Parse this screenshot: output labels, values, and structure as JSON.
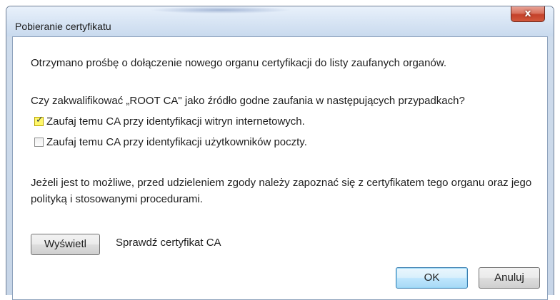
{
  "window": {
    "title": "Pobieranie certyfikatu",
    "close_label": "x"
  },
  "dialog": {
    "message": "Otrzymano prośbę o dołączenie nowego organu certyfikacji do listy zaufanych organów.",
    "question": "Czy zakwalifikować „ROOT CA\" jako źródło godne zaufania w następujących przypadkach?",
    "options": [
      {
        "label": "Zaufaj temu CA przy identyfikacji witryn internetowych.",
        "checked": true
      },
      {
        "label": "Zaufaj temu CA przy identyfikacji użytkowników poczty.",
        "checked": false
      }
    ],
    "advice": "Jeżeli jest to możliwe, przed udzieleniem zgody należy zapoznać się z certyfikatem tego organu oraz jego polityką i stosowanymi procedurami.",
    "view_button_label": "Wyświetl",
    "view_description": "Sprawdź certyfikat CA",
    "ok_label": "OK",
    "cancel_label": "Anuluj"
  },
  "colors": {
    "highlight": "#fff200",
    "default_button_border": "#3c7fb1",
    "close_button": "#c4412a"
  }
}
